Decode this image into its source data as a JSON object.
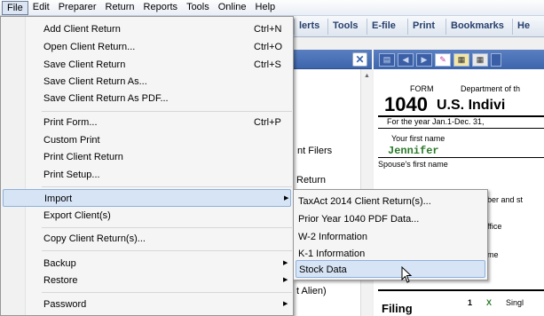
{
  "menubar": {
    "items": [
      "File",
      "Edit",
      "Preparer",
      "Return",
      "Reports",
      "Tools",
      "Online",
      "Help"
    ]
  },
  "toolbar": {
    "items": [
      "lerts",
      "Tools",
      "E-file",
      "Print",
      "Bookmarks",
      "He"
    ]
  },
  "background": {
    "line1": "nt Filers",
    "line2": "Return",
    "line3": "t Alien)"
  },
  "form": {
    "form_label": "FORM",
    "dept": "Department of th",
    "number": "1040",
    "title": "U.S. Indivi",
    "year_line": "For the year Jan.1-Dec. 31,",
    "first_name_label": "Your first name",
    "first_name_value": "Jennifer",
    "spouse_label": "Spouse's first name",
    "right_frag1": "ber and st",
    "right_frag2": "ffice",
    "right_frag3": "me",
    "filing_label": "Filing",
    "line_num": "1",
    "check": "X",
    "single": "Singl"
  },
  "file_menu": {
    "items": [
      {
        "label": "Add Client Return",
        "shortcut": "Ctrl+N"
      },
      {
        "label": "Open Client Return...",
        "shortcut": "Ctrl+O"
      },
      {
        "label": "Save Client Return",
        "shortcut": "Ctrl+S"
      },
      {
        "label": "Save Client Return As...",
        "shortcut": ""
      },
      {
        "label": "Save Client Return As PDF...",
        "shortcut": ""
      },
      {
        "label": "Print Form...",
        "shortcut": "Ctrl+P"
      },
      {
        "label": "Custom Print",
        "shortcut": ""
      },
      {
        "label": "Print Client Return",
        "shortcut": ""
      },
      {
        "label": "Print Setup...",
        "shortcut": ""
      },
      {
        "label": "Import",
        "shortcut": ""
      },
      {
        "label": "Export Client(s)",
        "shortcut": ""
      },
      {
        "label": "Copy Client Return(s)...",
        "shortcut": ""
      },
      {
        "label": "Backup",
        "shortcut": ""
      },
      {
        "label": "Restore",
        "shortcut": ""
      },
      {
        "label": "Password",
        "shortcut": ""
      }
    ]
  },
  "import_submenu": {
    "items": [
      "TaxAct 2014 Client Return(s)...",
      "Prior Year 1040 PDF Data...",
      "W-2 Information",
      "K-1 Information",
      "Stock Data"
    ]
  },
  "colors": {
    "accent": "#3d65ad",
    "highlight": "#d6e4f5",
    "name_green": "#2a7a2a"
  }
}
